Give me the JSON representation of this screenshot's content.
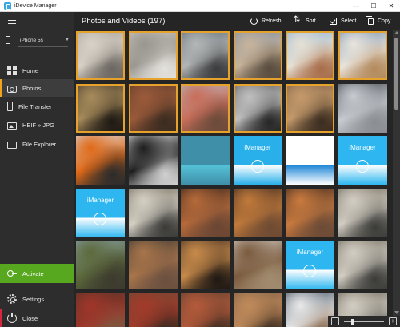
{
  "window": {
    "title": "iDevice Manager",
    "minimize_icon": "minimize-icon",
    "maximize_icon": "maximize-icon",
    "close_icon": "close-icon"
  },
  "sidebar": {
    "device": "iPhone 5s",
    "nav": [
      {
        "label": "Home",
        "icon": "home-icon"
      },
      {
        "label": "Photos",
        "icon": "camera-icon",
        "active": true
      },
      {
        "label": "File Transfer",
        "icon": "phone-icon"
      },
      {
        "label": "HEIF » JPG",
        "icon": "image-icon"
      },
      {
        "label": "File Explorer",
        "icon": "folder-icon"
      }
    ],
    "activate": "Activate",
    "settings": "Settings",
    "close": "Close"
  },
  "main": {
    "title": "Photos and Videos (197)",
    "toolbar": {
      "refresh": "Refresh",
      "sort": "Sort",
      "select": "Select",
      "copy": "Copy"
    }
  },
  "photos": {
    "columns": 6,
    "selected_count": 11,
    "items": [
      {
        "kind": "photo",
        "subject": "city-haze",
        "selected": true,
        "colors": [
          "#a79f98",
          "#d7d1c6",
          "#6b6660"
        ]
      },
      {
        "kind": "photo",
        "subject": "perforated-building",
        "selected": true,
        "colors": [
          "#ccc9c2",
          "#9a9690",
          "#e3e1dc"
        ]
      },
      {
        "kind": "photo",
        "subject": "modern-building",
        "selected": true,
        "colors": [
          "#5f6c7a",
          "#b3b6b5",
          "#3a3c3e"
        ]
      },
      {
        "kind": "photo",
        "subject": "plaza-street",
        "selected": true,
        "colors": [
          "#7a8ea8",
          "#c7b39a",
          "#594c3e"
        ]
      },
      {
        "kind": "photo",
        "subject": "courtyard-arches",
        "selected": true,
        "colors": [
          "#8bb1d7",
          "#e6e0d3",
          "#a86d4a"
        ]
      },
      {
        "kind": "photo",
        "subject": "white-buildings",
        "selected": true,
        "colors": [
          "#6f8fb1",
          "#e9e4dc",
          "#b48a5d"
        ]
      },
      {
        "kind": "photo",
        "subject": "silver-teapots",
        "selected": true,
        "colors": [
          "#3d3327",
          "#a78b5b",
          "#1e1914"
        ]
      },
      {
        "kind": "photo",
        "subject": "red-wall",
        "selected": true,
        "colors": [
          "#5a3a2a",
          "#9b5a3a",
          "#3a2b20"
        ]
      },
      {
        "kind": "photo",
        "subject": "pink-street",
        "selected": true,
        "colors": [
          "#b5b9c3",
          "#c96e5a",
          "#6b4a3a"
        ]
      },
      {
        "kind": "photo",
        "subject": "palm-leaves",
        "selected": true,
        "colors": [
          "#5a5a5a",
          "#bfbfbf",
          "#262626"
        ]
      },
      {
        "kind": "photo",
        "subject": "market-crowd",
        "selected": true,
        "colors": [
          "#7b5d45",
          "#c49a6b",
          "#3b2c20"
        ]
      },
      {
        "kind": "photo",
        "subject": "sports-car",
        "selected": false,
        "colors": [
          "#3a4049",
          "#c7cbd0",
          "#8a8e93"
        ]
      },
      {
        "kind": "photo",
        "subject": "orange-car",
        "selected": false,
        "colors": [
          "#d9e0e8",
          "#e06a18",
          "#2b2b2b"
        ]
      },
      {
        "kind": "photo",
        "subject": "black-racecar",
        "selected": false,
        "colors": [
          "#f0f0f0",
          "#1e1e1e",
          "#d0d0d0"
        ]
      },
      {
        "kind": "screenshot",
        "subject": "control-center",
        "selected": false,
        "colors": [
          "#3f8fa8",
          "#54c2d8",
          "#2a2a2a"
        ]
      },
      {
        "kind": "screenshot",
        "subject": "imanager-dialog",
        "selected": false,
        "colors": [
          "#29b0ea",
          "#ffffff",
          "#8fdcff"
        ],
        "text": "iManager"
      },
      {
        "kind": "screenshot",
        "subject": "settings-list",
        "selected": false,
        "colors": [
          "#ffffff",
          "#1d86d6",
          "#e3e3e3"
        ]
      },
      {
        "kind": "screenshot",
        "subject": "imanager-wifi",
        "selected": false,
        "colors": [
          "#2db6f0",
          "#ffffff",
          "#8fdcff"
        ],
        "text": "iManager"
      },
      {
        "kind": "screenshot",
        "subject": "imanager-start",
        "selected": false,
        "colors": [
          "#2db6f0",
          "#ffffff",
          "#8fdcff"
        ],
        "text": "iManager"
      },
      {
        "kind": "photo",
        "subject": "rose-stones",
        "selected": false,
        "colors": [
          "#6a6355",
          "#d4cfc3",
          "#3a3a38"
        ]
      },
      {
        "kind": "photo",
        "subject": "night-market",
        "selected": false,
        "colors": [
          "#2a1e18",
          "#b66a3a",
          "#6a4633"
        ]
      },
      {
        "kind": "photo",
        "subject": "night-market-2",
        "selected": false,
        "colors": [
          "#2d2120",
          "#c17a3a",
          "#6e4a33"
        ]
      },
      {
        "kind": "photo",
        "subject": "night-market-3",
        "selected": false,
        "colors": [
          "#2a1f1d",
          "#c97a3e",
          "#6a4a36"
        ]
      },
      {
        "kind": "photo",
        "subject": "rose-stones-2",
        "selected": false,
        "colors": [
          "#6a6357",
          "#d2cdc2",
          "#3b3b38"
        ]
      },
      {
        "kind": "photo",
        "subject": "palms-walkway",
        "selected": false,
        "colors": [
          "#8aa3ad",
          "#5d6a3c",
          "#3c3a2e"
        ]
      },
      {
        "kind": "photo",
        "subject": "busy-square",
        "selected": false,
        "colors": [
          "#333",
          "#a8754a",
          "#6b5040"
        ]
      },
      {
        "kind": "photo",
        "subject": "lantern-alley",
        "selected": false,
        "colors": [
          "#3a2a20",
          "#c78a4a",
          "#1f1814"
        ]
      },
      {
        "kind": "photo",
        "subject": "white-arches",
        "selected": false,
        "colors": [
          "#d7d3cd",
          "#7b5b3f",
          "#a28c70"
        ]
      },
      {
        "kind": "screenshot",
        "subject": "imanager-message",
        "selected": false,
        "colors": [
          "#2db6f0",
          "#ffffff",
          "#8fdcff"
        ],
        "text": "iManager"
      },
      {
        "kind": "photo",
        "subject": "rose-stones-3",
        "selected": false,
        "colors": [
          "#6a6357",
          "#d2cdc2",
          "#3b3b38"
        ]
      },
      {
        "kind": "photo",
        "subject": "crowd-row",
        "selected": false,
        "colors": [
          "#4a3526",
          "#a1352a",
          "#7a5a40"
        ]
      },
      {
        "kind": "photo",
        "subject": "crowd-row-2",
        "selected": false,
        "colors": [
          "#6a4a35",
          "#a23a2a",
          "#3a2a20"
        ]
      },
      {
        "kind": "photo",
        "subject": "crowd-row-3",
        "selected": false,
        "colors": [
          "#5a3e30",
          "#b45a3a",
          "#3e2c22"
        ]
      },
      {
        "kind": "photo",
        "subject": "crowd-row-4",
        "selected": false,
        "colors": [
          "#7a5d45",
          "#c08a5a",
          "#3b2c20"
        ]
      },
      {
        "kind": "photo",
        "subject": "crowd-row-5",
        "selected": false,
        "colors": [
          "#3a4a5a",
          "#e9e9e9",
          "#8a6a50"
        ]
      },
      {
        "kind": "photo",
        "subject": "crowd-row-6",
        "selected": false,
        "colors": [
          "#6a6357",
          "#d2cdc2",
          "#3b3b38"
        ]
      }
    ]
  },
  "zoom": {
    "minus": "−",
    "plus": "+",
    "level": 0.2
  },
  "colors": {
    "accent": "#e6a22a",
    "activate_green": "#57a81f",
    "close_red": "#d7263d",
    "sidebar_bg": "#2d2d2d",
    "main_bg": "#252525"
  }
}
